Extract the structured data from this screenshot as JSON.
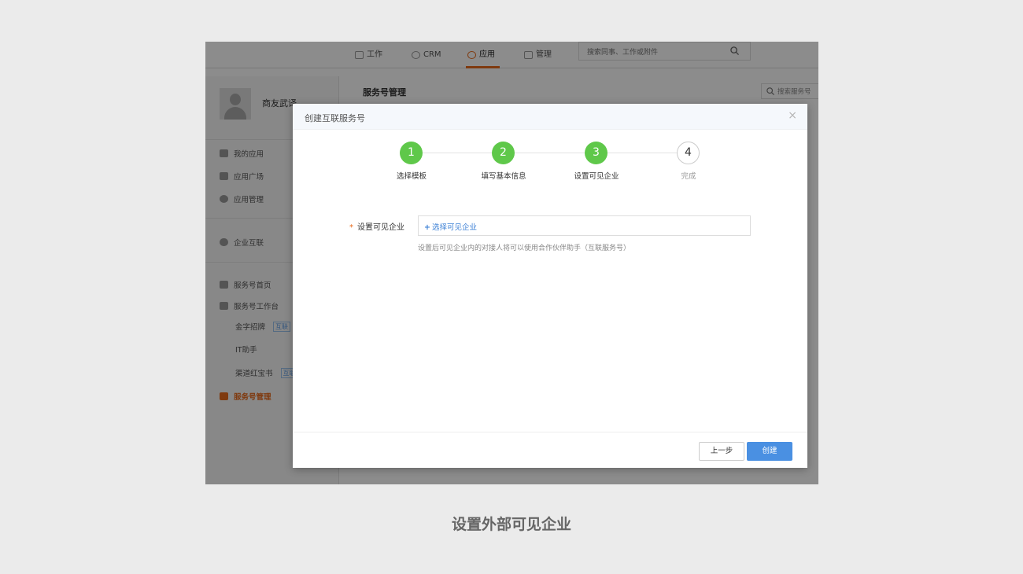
{
  "topnav": {
    "items": [
      {
        "label": "工作",
        "icon": "work-icon"
      },
      {
        "label": "CRM",
        "icon": "crm-icon"
      },
      {
        "label": "应用",
        "icon": "app-icon",
        "active": true
      },
      {
        "label": "管理",
        "icon": "manage-icon"
      }
    ],
    "search_placeholder": "搜索同事、工作或附件"
  },
  "sidebar": {
    "username": "商友武译",
    "items": [
      {
        "label": "我的应用",
        "icon": "my-apps-icon"
      },
      {
        "label": "应用广场",
        "icon": "app-square-icon"
      },
      {
        "label": "应用管理",
        "icon": "gear-icon"
      },
      {
        "label": "企业互联",
        "icon": "link-icon"
      },
      {
        "label": "服务号首页",
        "icon": "home-icon"
      },
      {
        "label": "服务号工作台",
        "icon": "monitor-icon"
      },
      {
        "label": "金字招牌",
        "tag": "互联"
      },
      {
        "label": "IT助手"
      },
      {
        "label": "渠道红宝书",
        "tag": "互联"
      },
      {
        "label": "服务号管理",
        "icon": "service-manage-icon",
        "active": true
      }
    ]
  },
  "main": {
    "title": "服务号管理",
    "search_placeholder": "搜索服务号"
  },
  "dialog": {
    "title": "创建互联服务号",
    "close": "×",
    "steps": [
      {
        "num": "1",
        "label": "选择模板",
        "done": true
      },
      {
        "num": "2",
        "label": "填写基本信息",
        "done": true
      },
      {
        "num": "3",
        "label": "设置可见企业",
        "done": true
      },
      {
        "num": "4",
        "label": "完成",
        "done": false
      }
    ],
    "field": {
      "required_mark": "*",
      "label": "设置可见企业",
      "link_plus": "+",
      "link": "选择可见企业",
      "hint": "设置后可见企业内的对接人将可以使用合作伙伴助手（互联服务号）"
    },
    "buttons": {
      "prev": "上一步",
      "create": "创建"
    }
  },
  "caption": "设置外部可见企业",
  "colors": {
    "accent": "#e86a1c",
    "step_done": "#5fc84a",
    "primary_button": "#4a90e2",
    "link": "#3a7fd5"
  }
}
